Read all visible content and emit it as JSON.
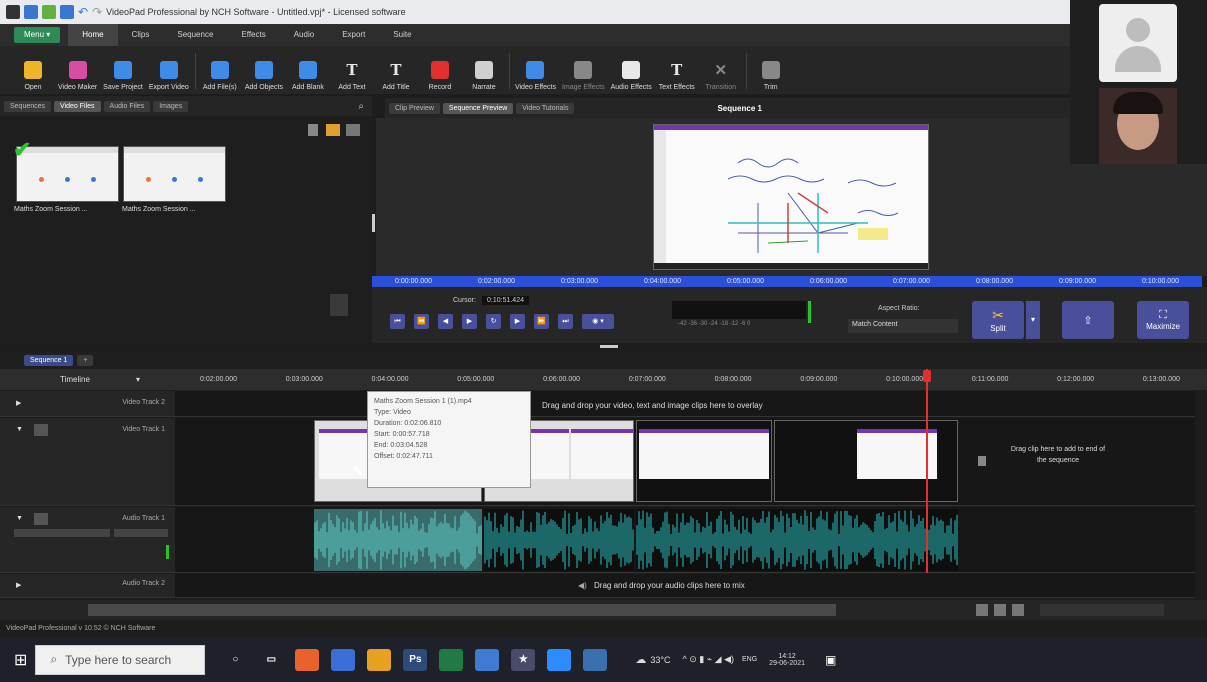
{
  "title": "VideoPad Professional by NCH Software - Untitled.vpj* - Licensed software",
  "colors": {
    "accent": "#2a4fd8",
    "purple": "#4a4f9c",
    "teal": "#2bc0c0",
    "red": "#e03030",
    "green": "#2e8b57"
  },
  "menubar": {
    "menu": "Menu ▾",
    "tabs": [
      "Home",
      "Clips",
      "Sequence",
      "Effects",
      "Audio",
      "Export",
      "Suite"
    ],
    "active": "Home"
  },
  "toolbar": [
    {
      "label": "Open",
      "icon": "folder-icon",
      "color": "#f0b429"
    },
    {
      "label": "Video Maker",
      "icon": "flask-icon",
      "color": "#d64da3"
    },
    {
      "label": "Save Project",
      "icon": "save-icon",
      "color": "#3f8be8"
    },
    {
      "label": "Export Video",
      "icon": "export-icon",
      "color": "#3f8be8"
    },
    {
      "label": "Add File(s)",
      "icon": "add-file-icon",
      "color": "#3f8be8"
    },
    {
      "label": "Add Objects",
      "icon": "add-objects-icon",
      "color": "#3f8be8"
    },
    {
      "label": "Add Blank",
      "icon": "add-blank-icon",
      "color": "#3f8be8"
    },
    {
      "label": "Add Text",
      "icon": "text-icon",
      "color": "#e8e8e8",
      "glyph": "T"
    },
    {
      "label": "Add Title",
      "icon": "title-icon",
      "color": "#e8e8e8",
      "glyph": "T"
    },
    {
      "label": "Record",
      "icon": "record-icon",
      "color": "#e03030"
    },
    {
      "label": "Narrate",
      "icon": "microphone-icon",
      "color": "#cfcfcf"
    },
    {
      "label": "Video Effects",
      "icon": "video-effects-icon",
      "color": "#3f8be8"
    },
    {
      "label": "Image Effects",
      "icon": "image-effects-icon",
      "color": "#888",
      "dim": true
    },
    {
      "label": "Audio Effects",
      "icon": "audio-effects-icon",
      "color": "#e8e8e8"
    },
    {
      "label": "Text Effects",
      "icon": "text-effects-icon",
      "color": "#e8e8e8",
      "glyph": "T"
    },
    {
      "label": "Transition",
      "icon": "transition-icon",
      "color": "#888",
      "dim": true,
      "glyph": "✕"
    },
    {
      "label": "Trim",
      "icon": "trim-icon",
      "color": "#888"
    }
  ],
  "bin": {
    "tabs": [
      "Sequences",
      "Video Files",
      "Audio Files",
      "Images"
    ],
    "active": "Video Files",
    "clips": [
      {
        "label": "Maths Zoom Session ..."
      },
      {
        "label": "Maths Zoom Session ..."
      }
    ]
  },
  "preview": {
    "tabs": [
      "Clip Preview",
      "Sequence Preview",
      "Video Tutorials"
    ],
    "active": "Sequence Preview",
    "sequence_title": "Sequence 1",
    "ruler": [
      "0:00:00.000",
      "0:02:00.000",
      "0:03:00.000",
      "0:04:00.000",
      "0:05:00.000",
      "0:06:00.000",
      "0:07:00.000",
      "0:08:00.000",
      "0:09:00.000",
      "0:10:00.000"
    ],
    "cursor_label": "Cursor:",
    "cursor_value": "0:10:51.424",
    "meter": "-42 -36 -30 -24 -18 -12 -6 0",
    "aspect_label": "Aspect Ratio:",
    "aspect_value": "Match Content",
    "split": "Split",
    "maximize": "Maximize"
  },
  "timeline": {
    "seq_tab": "Sequence 1",
    "label": "Timeline",
    "ruler": [
      "0:02:00.000",
      "0:03:00.000",
      "0:04:00.000",
      "0:05:00.000",
      "0:06:00.000",
      "0:07:00.000",
      "0:08:00.000",
      "0:09:00.000",
      "0:10:00.000",
      "0:11:00.000",
      "0:12:00.000",
      "0:13:00.000"
    ],
    "tracks": {
      "video2": "Video Track 2",
      "video1": "Video Track 1",
      "audio1": "Audio Track 1",
      "audio2": "Audio Track 2"
    },
    "overlay_hint": "Drag and drop your video, text and image clips here to overlay",
    "add_hint": "Drag clip here to add to end of the sequence",
    "audio_hint": "Drag and drop your audio clips here to mix"
  },
  "tooltip": {
    "name": "Maths Zoom Session 1 (1).mp4",
    "type": "Type: Video",
    "duration": "Duration: 0:02:06.810",
    "start": "Start: 0:00:57.718",
    "end": "End: 0:03:04.528",
    "offset": "Offset: 0:02:47.711"
  },
  "status": "VideoPad Professional v 10.52 © NCH Software",
  "taskbar": {
    "search_placeholder": "Type here to search",
    "temp": "33°C",
    "lang": "ENG",
    "time": "14:12",
    "date": "29-06-2021"
  }
}
